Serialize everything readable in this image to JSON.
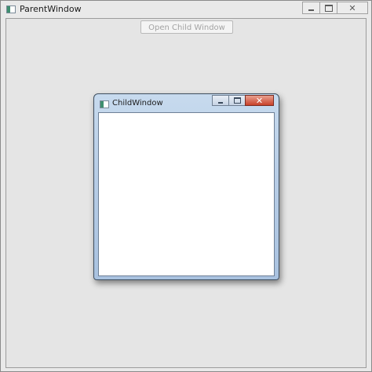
{
  "parent_window": {
    "title": "ParentWindow",
    "icon": "window-app-icon",
    "open_child_button_label": "Open Child Window",
    "open_child_button_state": "disabled",
    "caption_buttons": [
      "minimize-icon",
      "maximize-icon",
      "close-icon"
    ]
  },
  "child_window": {
    "title": "ChildWindow",
    "icon": "window-app-icon",
    "caption_buttons": [
      "minimize-icon",
      "maximize-icon",
      "close-icon"
    ],
    "close_button_color": "#c8412a"
  },
  "colors": {
    "parent_background": "#e5e5e5",
    "child_frame": "#b7cde6",
    "child_client": "#ffffff"
  }
}
